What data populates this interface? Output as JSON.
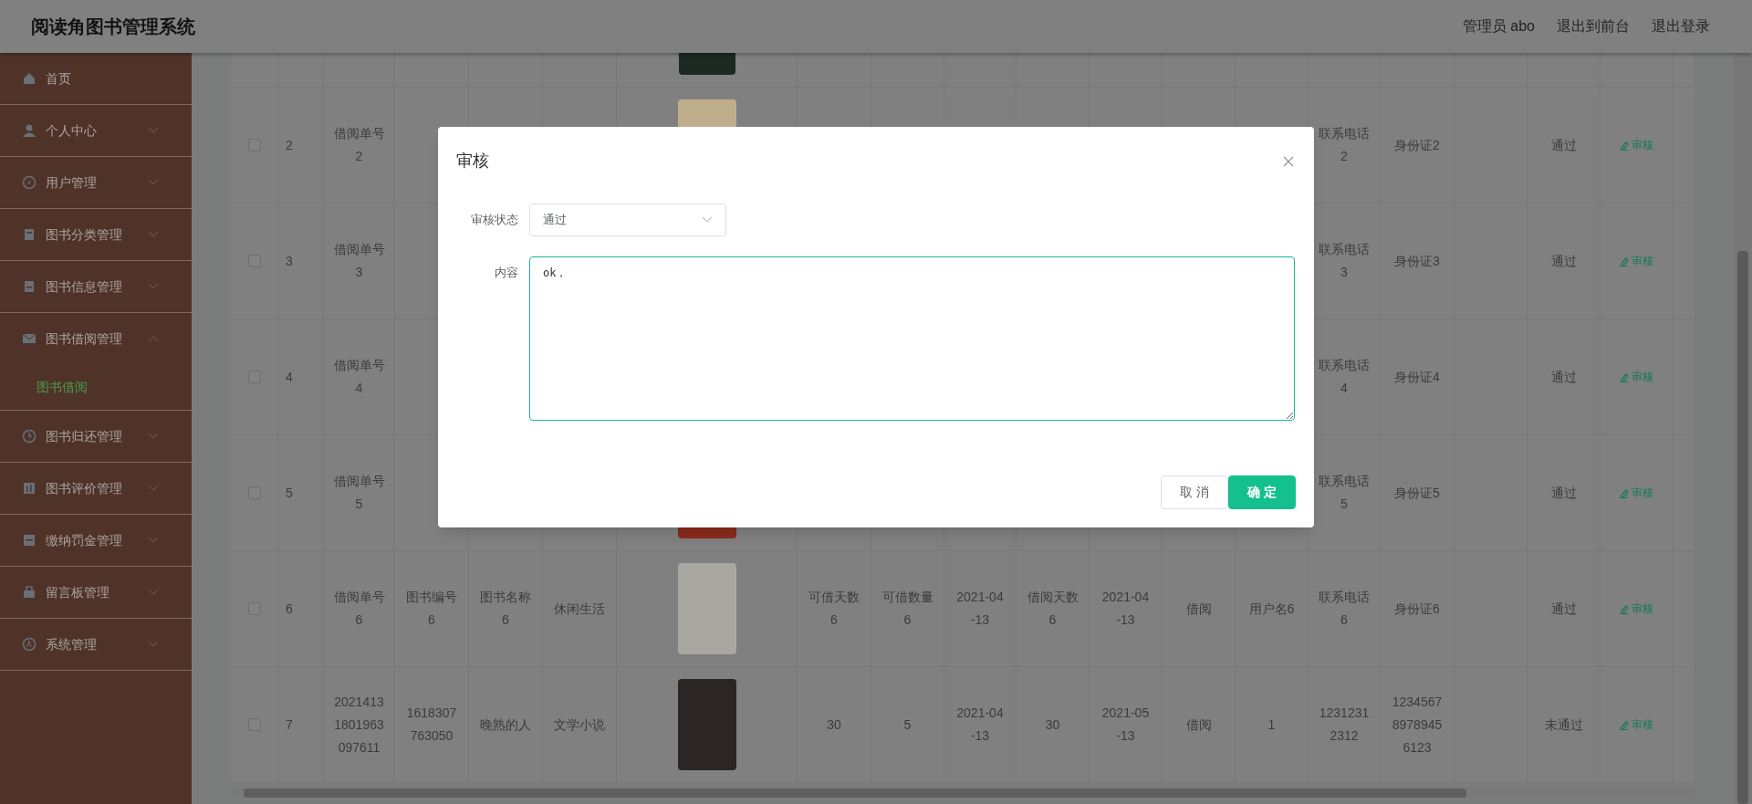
{
  "header": {
    "title": "阅读角图书管理系统",
    "links": [
      "管理员 abo",
      "退出到前台",
      "退出登录"
    ]
  },
  "sidebar": {
    "items": [
      {
        "label": "首页",
        "kind": "link"
      },
      {
        "label": "个人中心",
        "kind": "menu",
        "expanded": false
      },
      {
        "label": "用户管理",
        "kind": "menu",
        "expanded": false
      },
      {
        "label": "图书分类管理",
        "kind": "menu",
        "expanded": false
      },
      {
        "label": "图书信息管理",
        "kind": "menu",
        "expanded": false
      },
      {
        "label": "图书借阅管理",
        "kind": "menu",
        "expanded": true,
        "children": [
          {
            "label": "图书借阅",
            "selected": true
          }
        ]
      },
      {
        "label": "图书归还管理",
        "kind": "menu",
        "expanded": false
      },
      {
        "label": "图书评价管理",
        "kind": "menu",
        "expanded": false
      },
      {
        "label": "缴纳罚金管理",
        "kind": "menu",
        "expanded": false
      },
      {
        "label": "留言板管理",
        "kind": "menu",
        "expanded": false
      },
      {
        "label": "系统管理",
        "kind": "menu",
        "expanded": false
      }
    ]
  },
  "table": {
    "rows": [
      {
        "checked": false,
        "column_2": "2",
        "column_3": "借阅单号\n2",
        "column_15": "联系电话\n2",
        "column_16": "身份证2",
        "column_18": "通过",
        "action": "审核"
      },
      {
        "checked": false,
        "column_2": "3",
        "column_3": "借阅单号\n3",
        "column_15": "联系电话\n3",
        "column_16": "身份证3",
        "column_18": "通过",
        "action": "审核"
      },
      {
        "checked": false,
        "column_2": "4",
        "column_3": "借阅单号\n4",
        "column_15": "联系电话\n4",
        "column_16": "身份证4",
        "column_18": "通过",
        "action": "审核"
      },
      {
        "checked": false,
        "column_2": "5",
        "column_3": "借阅单号\n5",
        "column_15": "联系电话\n5",
        "column_16": "身份证5",
        "column_18": "通过",
        "action": "审核"
      },
      {
        "checked": false,
        "column_2": "6",
        "column_3": "借阅单号\n6",
        "column_4": "图书编号\n6",
        "column_5": "图书名称\n6",
        "column_6": "休闲生活",
        "column_8": "可借天数\n6",
        "column_9": "可借数量\n6",
        "column_10": "2021-04\n-13",
        "column_11": "借阅天数\n6",
        "column_12": "2021-04\n-13",
        "column_13": "借阅",
        "column_14": "用户名6",
        "column_15": "联系电话\n6",
        "column_16": "身份证6",
        "column_18": "通过",
        "action": "审核"
      },
      {
        "checked": false,
        "column_2": "7",
        "column_3": "2021413\n1801963\n097611",
        "column_4": "1618307\n763050",
        "column_5": "晚熟的人",
        "column_6": "文学小说",
        "column_8": "30",
        "column_9": "5",
        "column_10": "2021-04\n-13",
        "column_11": "30",
        "column_12": "2021-05\n-13",
        "column_13": "借阅",
        "column_14": "1",
        "column_15": "1231231\n2312",
        "column_16": "1234567\n8978945\n6123",
        "column_18": "未通过",
        "action": "审核"
      }
    ]
  },
  "dialog": {
    "title": "审核",
    "fields": [
      {
        "kind": "select",
        "label": "审核状态",
        "value": "通过"
      },
      {
        "kind": "textarea",
        "label": "内容",
        "value": "ok，"
      }
    ],
    "buttons": [
      {
        "label": "取消",
        "kind": "secondary"
      },
      {
        "label": "确定",
        "kind": "primary"
      }
    ]
  }
}
